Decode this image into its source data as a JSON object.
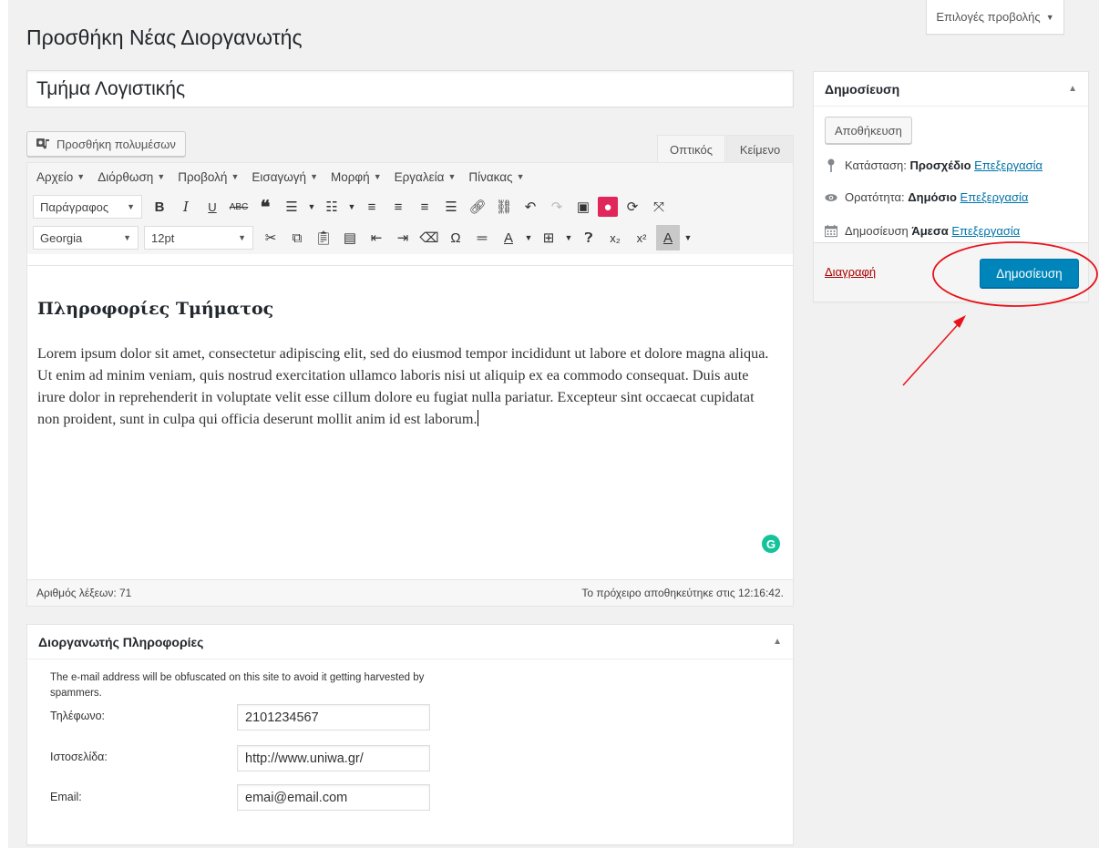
{
  "screen_options": {
    "label": "Επιλογές προβολής",
    "caret": "▼"
  },
  "page_title": "Προσθήκη Νέας Διοργανωτής",
  "post_title": "Τμήμα Λογιστικής",
  "add_media_label": "Προσθήκη πολυμέσων",
  "editor_tabs": {
    "visual": "Οπτικός",
    "text": "Κείμενο"
  },
  "menubar": [
    {
      "label": "Αρχείο"
    },
    {
      "label": "Διόρθωση"
    },
    {
      "label": "Προβολή"
    },
    {
      "label": "Εισαγωγή"
    },
    {
      "label": "Μορφή"
    },
    {
      "label": "Εργαλεία"
    },
    {
      "label": "Πίνακας"
    }
  ],
  "toolbar": {
    "format_select": "Παράγραφος",
    "font_select": "Georgia",
    "size_select": "12pt"
  },
  "content": {
    "heading": "Πληροφορίες Τμήματος",
    "paragraph": "Lorem ipsum dolor sit amet, consectetur adipiscing elit, sed do eiusmod tempor incididunt ut labore et dolore magna aliqua. Ut enim ad minim veniam, quis nostrud exercitation ullamco laboris nisi ut aliquip ex ea commodo consequat. Duis aute irure dolor in reprehenderit in voluptate velit esse cillum dolore eu fugiat nulla pariatur. Excepteur sint occaecat cupidatat non proident, sunt in culpa qui officia deserunt mollit anim id est laborum."
  },
  "status": {
    "word_count": "Αριθμός λέξεων: 71",
    "draft_saved": "Το πρόχειρο αποθηκεύτηκε στις 12:16:42."
  },
  "organizer_box": {
    "title": "Διοργανωτής Πληροφορίες",
    "description": "The e-mail address will be obfuscated on this site to avoid it getting harvested by spammers.",
    "fields": {
      "phone": {
        "label": "Τηλέφωνο:",
        "value": "2101234567"
      },
      "website": {
        "label": "Ιστοσελίδα:",
        "value": "http://www.uniwa.gr/"
      },
      "email": {
        "label": "Email:",
        "value": "emai@email.com"
      }
    }
  },
  "publish_box": {
    "title": "Δημοσίευση",
    "save_label": "Αποθήκευση",
    "status_label": "Κατάσταση:",
    "status_value": "Προσχέδιο",
    "visibility_label": "Ορατότητα:",
    "visibility_value": "Δημόσιο",
    "schedule_label": "Δημοσίευση",
    "schedule_value": "Άμεσα",
    "edit_link": "Επεξεργασία",
    "delete_label": "Διαγραφή",
    "publish_label": "Δημοσίευση"
  },
  "colors": {
    "primary": "#0085ba",
    "delete": "#aa0000",
    "link": "#0073aa",
    "annotation": "#e8121a",
    "grammarly": "#15c39a"
  }
}
